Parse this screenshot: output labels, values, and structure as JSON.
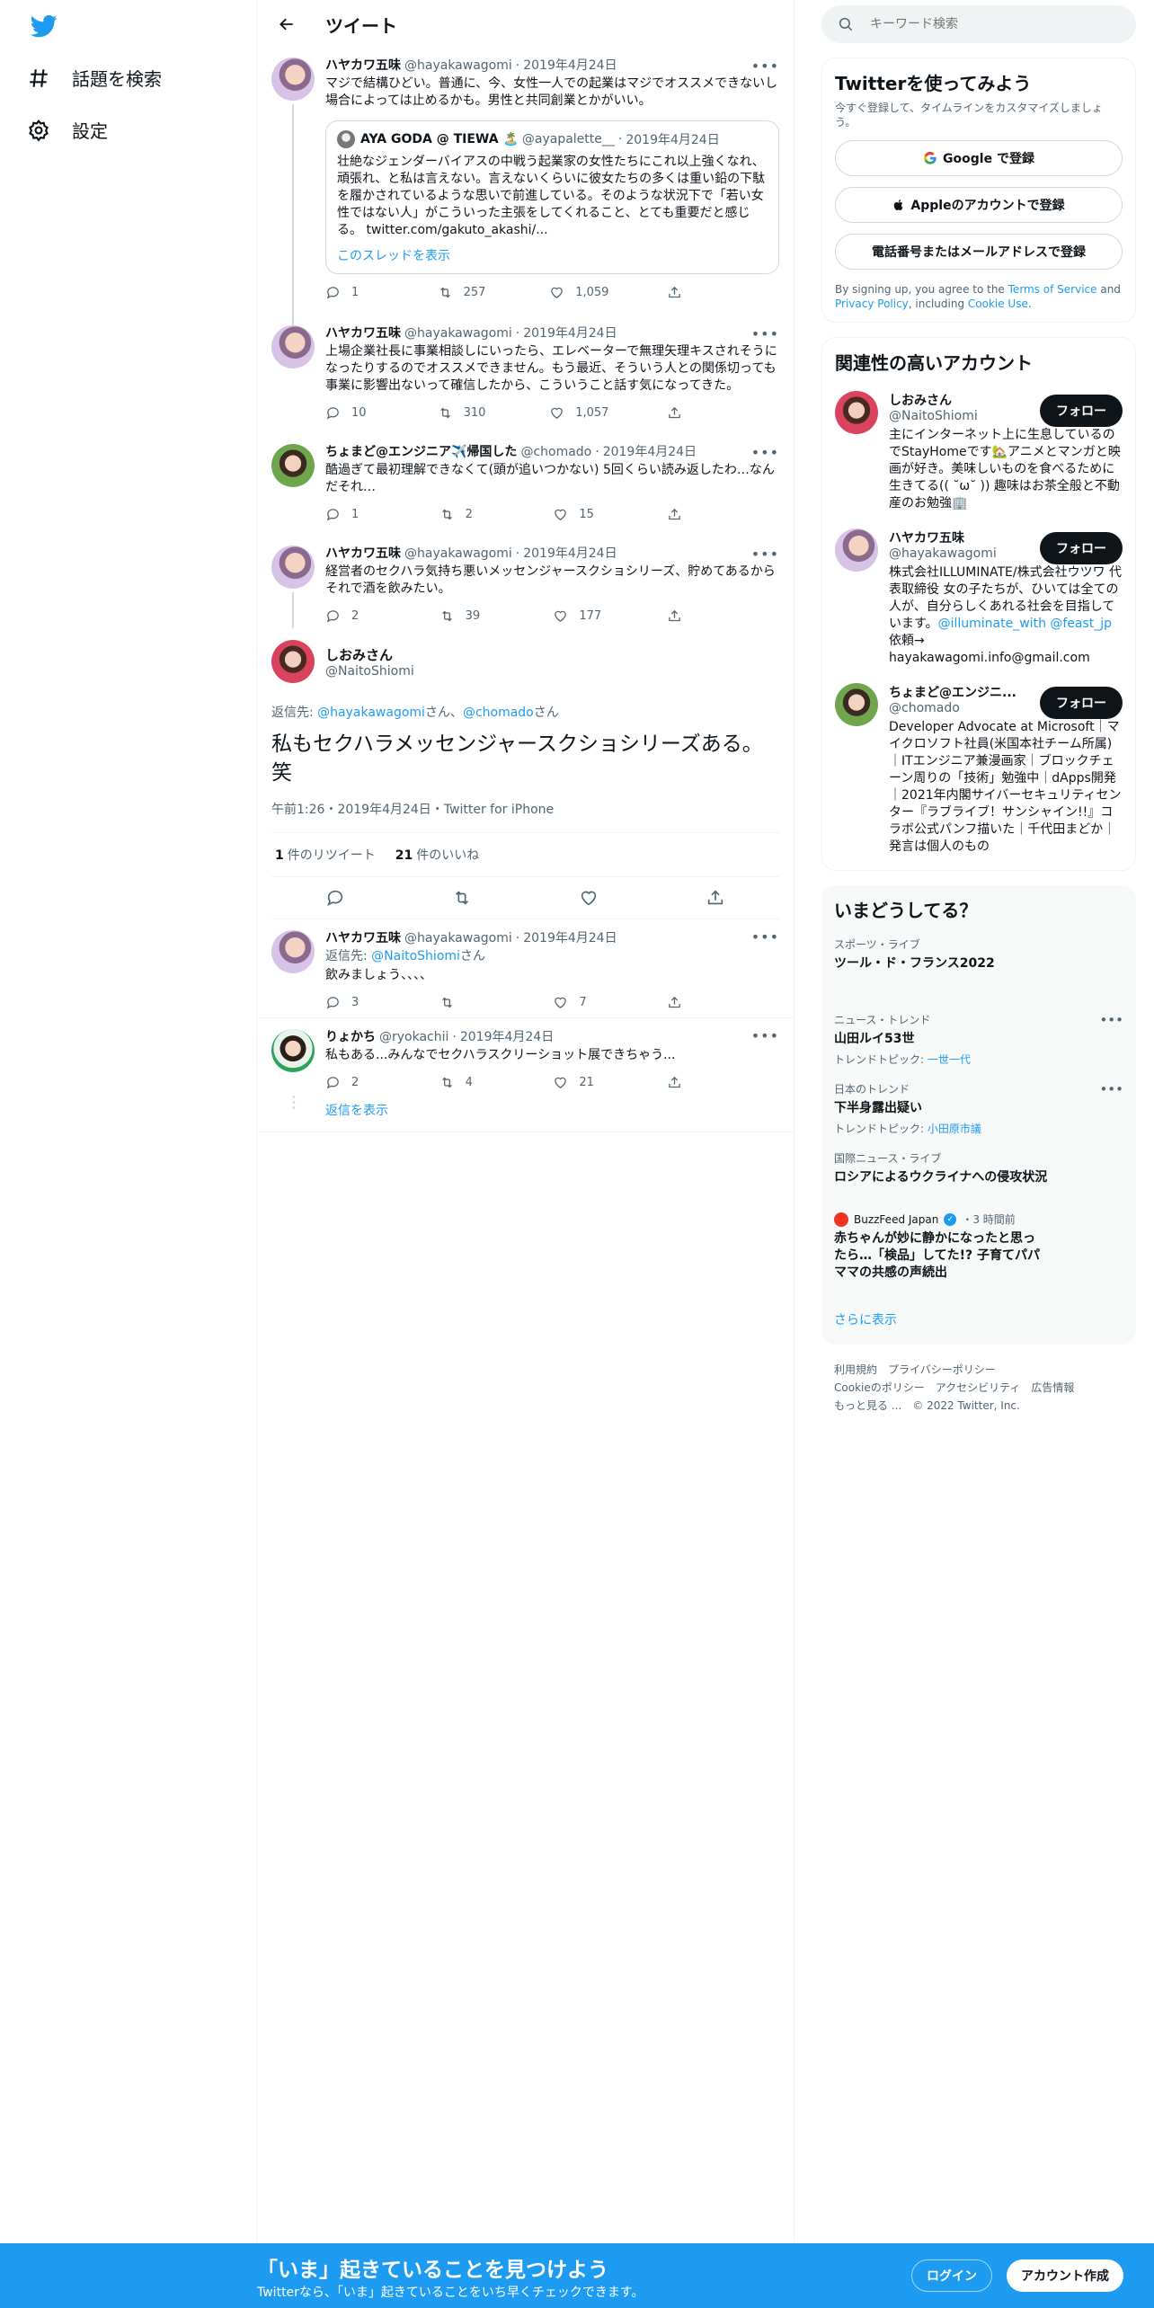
{
  "nav": {
    "explore_label": "話題を検索",
    "settings_label": "設定"
  },
  "header": {
    "title": "ツイート"
  },
  "tweets": [
    {
      "name": "ハヤカワ五味",
      "handle": "@hayakawagomi",
      "date": "2019年4月24日",
      "text": "マジで結構ひどい。普通に、今、女性一人での起業はマジでオススメできないし場合によっては止めるかも。男性と共同創業とかがいい。",
      "quote": {
        "name": "AYA GODA @ TIEWA 🏝️",
        "handle": "@ayapalette__",
        "date": "2019年4月24日",
        "text": "壮絶なジェンダーバイアスの中戦う起業家の女性たちにこれ以上強くなれ、頑張れ、と私は言えない。言えないくらいに彼女たちの多くは重い鉛の下駄を履かされているような思いで前進している。そのような状況下で「若い女性ではない人」がこういった主張をしてくれること、とても重要だと感じる。 twitter.com/gakuto_akashi/..."
      },
      "show_thread": "このスレッドを表示",
      "replies": "1",
      "retweets": "257",
      "likes": "1,059"
    },
    {
      "name": "ハヤカワ五味",
      "handle": "@hayakawagomi",
      "date": "2019年4月24日",
      "text": "上場企業社長に事業相談しにいったら、エレベーターで無理矢理キスされそうになったりするのでオススメできません。もう最近、そういう人との関係切っても事業に影響出ないって確信したから、こういうこと話す気になってきた。",
      "replies": "10",
      "retweets": "310",
      "likes": "1,057"
    },
    {
      "name": "ちょまど@エンジニア✈️帰国した",
      "handle": "@chomado",
      "date": "2019年4月24日",
      "text": "酷過ぎて最初理解できなくて(頭が追いつかない) 5回くらい読み返したわ…なんだそれ…",
      "replies": "1",
      "retweets": "2",
      "likes": "15"
    },
    {
      "name": "ハヤカワ五味",
      "handle": "@hayakawagomi",
      "date": "2019年4月24日",
      "text": "経営者のセクハラ気持ち悪いメッセンジャースクショシリーズ、貯めてあるからそれで酒を飲みたい。",
      "replies": "2",
      "retweets": "39",
      "likes": "177"
    }
  ],
  "focus": {
    "name": "しおみさん",
    "handle": "@NaitoShiomi",
    "reply_prefix": "返信先: ",
    "reply_user1": "@hayakawagomi",
    "reply_mid": "さん、",
    "reply_user2": "@chomado",
    "reply_suffix": "さん",
    "text": "私もセクハラメッセンジャースクショシリーズある。笑",
    "meta": "午前1:26・2019年4月24日・Twitter for iPhone",
    "retweet_count": "1",
    "retweet_label": "件のリツイート",
    "like_count": "21",
    "like_label": "件のいいね"
  },
  "replies": [
    {
      "name": "ハヤカワ五味",
      "handle": "@hayakawagomi",
      "date": "2019年4月24日",
      "reply_prefix": "返信先: ",
      "reply_user": "@NaitoShiomi",
      "reply_suffix": "さん",
      "text": "飲みましょう、、、、",
      "replies": "3",
      "retweets": "",
      "likes": "7"
    },
    {
      "name": "りょかち",
      "handle": "@ryokachii",
      "date": "2019年4月24日",
      "text": "私もある...みんなでセクハラスクリーショット展できちゃう...",
      "replies": "2",
      "retweets": "4",
      "likes": "21"
    }
  ],
  "show_replies": "返信を表示",
  "search": {
    "placeholder": "キーワード検索"
  },
  "signup_panel": {
    "title": "Twitterを使ってみよう",
    "subtitle": "今すぐ登録して、タイムラインをカスタマイズしましょう。",
    "google": "Google で登録",
    "apple": "Appleのアカウントで登録",
    "phone": "電話番号またはメールアドレスで登録",
    "terms_pre": "By signing up, you agree to the ",
    "terms_link": "Terms of Service",
    "terms_and": " and ",
    "privacy_link": "Privacy Policy",
    "terms_including": ", including ",
    "cookie_link": "Cookie Use",
    "terms_end": "."
  },
  "relevant": {
    "title": "関連性の高いアカウント",
    "follow_label": "フォロー",
    "accounts": [
      {
        "name": "しおみさん",
        "handle": "@NaitoShiomi",
        "bio": "主にインターネット上に生息しているのでStayHomeです🏡アニメとマンガと映画が好き。美味しいものを食べるために生きてる(( ˘ω˘ )) 趣味はお茶全般と不動産のお勉強🏢"
      },
      {
        "name": "ハヤカワ五味",
        "handle": "@hayakawagomi",
        "bio_pre": "株式会社ILLUMINATE/株式会社ウツワ 代表取締役 女の子たちが、ひいては全ての人が、自分らしくあれる社会を目指しています。",
        "bio_link1": "@illuminate_with",
        "bio_link2": "@feast_jp",
        "bio_post": " 依頼→ hayakawagomi.info@gmail.com"
      },
      {
        "name": "ちょまど@エンジニ...",
        "handle": "@chomado",
        "bio": "Developer Advocate at Microsoft｜マイクロソフト社員(米国本社チーム所属)｜ITエンジニア兼漫画家｜ブロックチェーン周りの「技術」勉強中｜dApps開発｜2021年内閣サイバーセキュリティセンター『ラブライブ！サンシャイン!!』コラボ公式パンフ描いた｜千代田まどか｜発言は個人のもの"
      }
    ]
  },
  "trends": {
    "title": "いまどうしてる？",
    "items": [
      {
        "category": "スポーツ・ライブ",
        "title": "ツール・ド・フランス2022"
      },
      {
        "category": "ニュース・トレンド",
        "title": "山田ルイ53世",
        "topic_label": "トレンドトピック: ",
        "topic": "一世一代"
      },
      {
        "category": "日本のトレンド",
        "title": "下半身露出疑い",
        "topic_label": "トレンドトピック: ",
        "topic": "小田原市議"
      },
      {
        "category": "国際ニュース・ライブ",
        "title": "ロシアによるウクライナへの侵攻状況"
      }
    ],
    "news": {
      "source": "BuzzFeed Japan",
      "time": "・3 時間前",
      "title": "赤ちゃんが妙に静かになったと思ったら…「検品」してた!? 子育てパパママの共感の声続出"
    },
    "show_more": "さらに表示"
  },
  "footer": {
    "links": [
      "利用規約",
      "プライバシーポリシー",
      "Cookieのポリシー",
      "アクセシビリティ",
      "広告情報",
      "もっと見る ..."
    ],
    "copyright": "© 2022 Twitter, Inc."
  },
  "banner": {
    "title": "「いま」起きていることを見つけよう",
    "subtitle": "Twitterなら、「いま」起きていることをいち早くチェックできます。",
    "login": "ログイン",
    "signup": "アカウント作成"
  },
  "colors": {
    "accent": "#1d9bf0",
    "text": "#0f1419",
    "muted": "#536471"
  }
}
